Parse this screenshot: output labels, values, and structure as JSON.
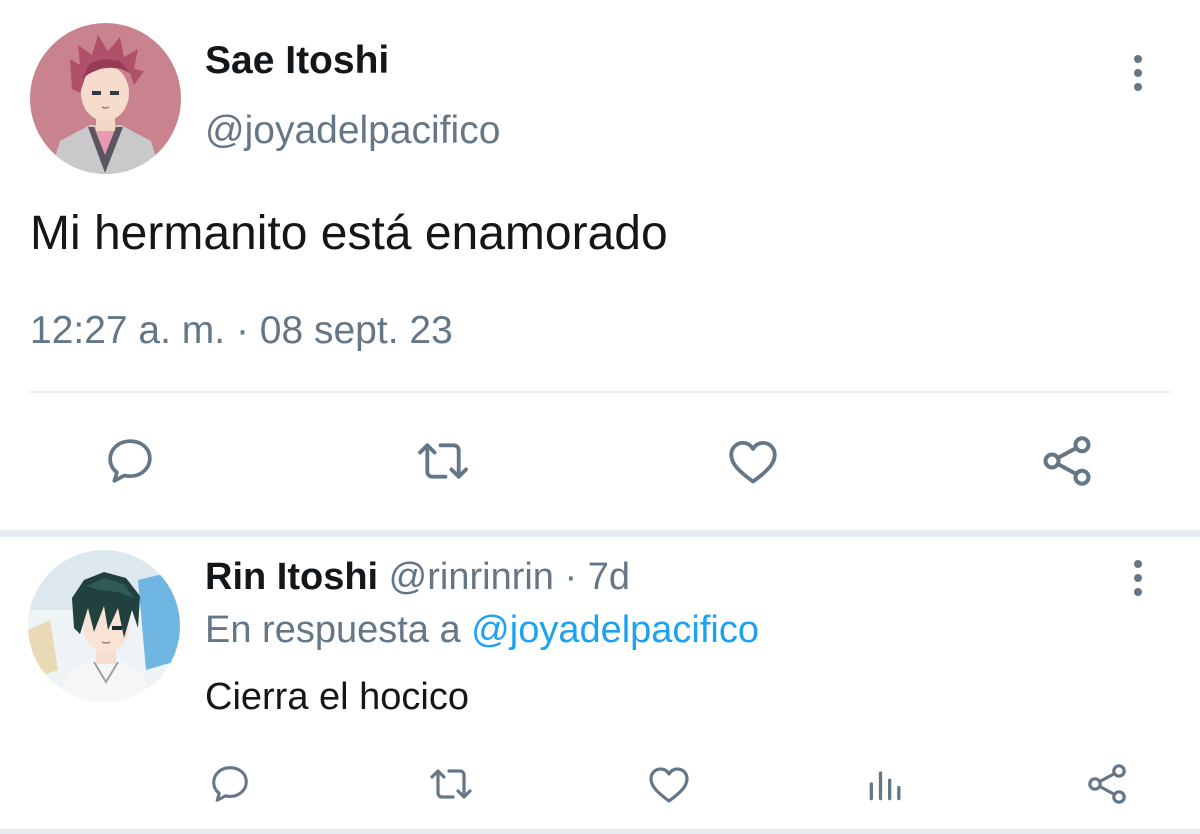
{
  "main_tweet": {
    "display_name": "Sae Itoshi",
    "handle": "@joyadelpacifico",
    "text": "Mi hermanito está enamorado",
    "timestamp": "12:27 a. m. · 08 sept. 23",
    "avatar_icon": "anime-avatar-pink-hair",
    "actions": [
      "reply-icon",
      "retweet-icon",
      "like-icon",
      "share-icon"
    ]
  },
  "reply_tweet": {
    "display_name": "Rin Itoshi",
    "handle": "@rinrinrin",
    "dot": " · ",
    "time": "7d",
    "reply_to_prefix": "En respuesta a ",
    "reply_to_handle": "@joyadelpacifico",
    "text": "Cierra el hocico",
    "avatar_icon": "anime-avatar-dark-hair",
    "actions": [
      "reply-icon",
      "retweet-icon",
      "like-icon",
      "analytics-icon",
      "share-icon"
    ]
  },
  "colors": {
    "text_primary": "#14171a",
    "text_secondary": "#657786",
    "link": "#1da1f2",
    "divider": "#e6ecf0",
    "icon": "#657786"
  }
}
